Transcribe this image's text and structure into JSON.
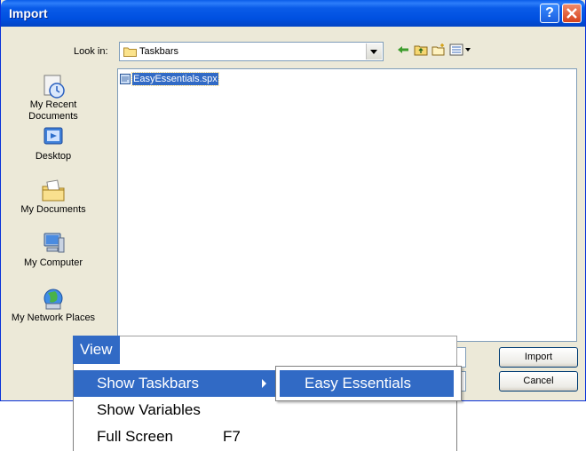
{
  "window": {
    "title": "Import",
    "help_glyph": "?"
  },
  "lookin": {
    "label": "Look in:",
    "value": "Taskbars"
  },
  "toolbar": {
    "icons": [
      "back-icon",
      "up-folder-icon",
      "new-folder-icon",
      "view-menu-icon"
    ]
  },
  "places": [
    {
      "label": "My Recent Documents",
      "icon": "recent-documents-icon"
    },
    {
      "label": "Desktop",
      "icon": "desktop-icon"
    },
    {
      "label": "My Documents",
      "icon": "my-documents-icon"
    },
    {
      "label": "My Computer",
      "icon": "my-computer-icon"
    },
    {
      "label": "My Network Places",
      "icon": "network-places-icon"
    }
  ],
  "files": [
    {
      "name": "EasyEssentials.spx",
      "selected": true
    }
  ],
  "buttons": {
    "import": "Import",
    "cancel": "Cancel"
  },
  "menu": {
    "title": "View",
    "items": [
      {
        "label": "Show Taskbars",
        "shortcut": "",
        "highlighted": true,
        "submenu": true
      },
      {
        "label": "Show Variables",
        "shortcut": ""
      },
      {
        "label": "Full Screen",
        "shortcut": "F7"
      }
    ],
    "submenu_items": [
      {
        "label": "Easy Essentials",
        "highlighted": true
      }
    ]
  },
  "colors": {
    "selection": "#316ac5",
    "titlebar": "#0a5ce8",
    "dialog_bg": "#ece9d8"
  }
}
